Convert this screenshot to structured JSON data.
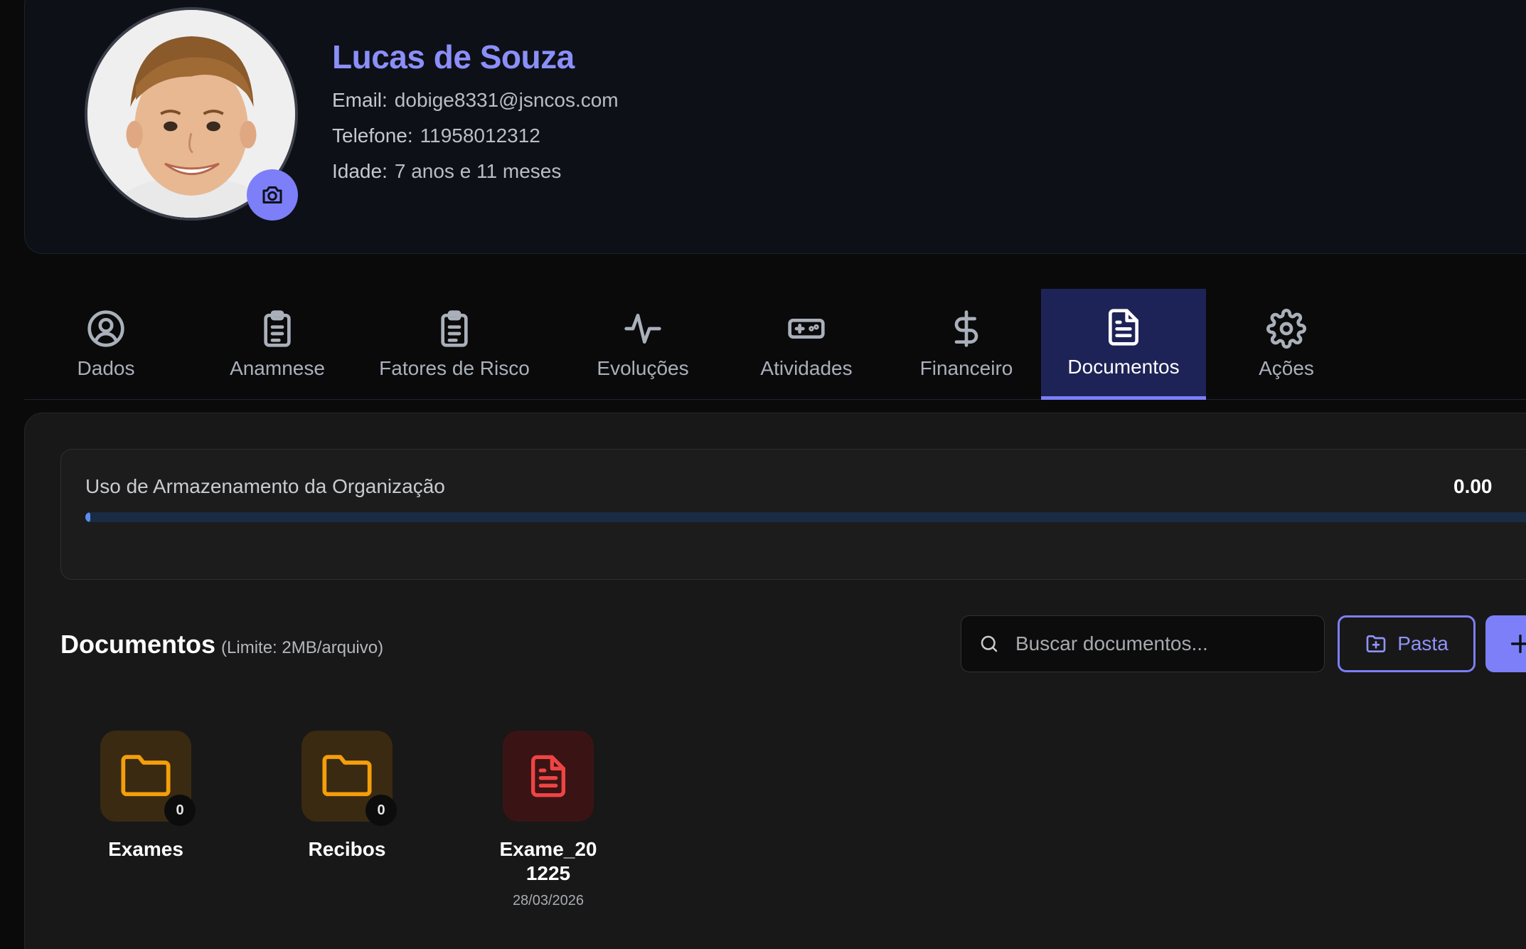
{
  "profile": {
    "name": "Lucas de Souza",
    "email_label": "Email:",
    "email": "dobige8331@jsncos.com",
    "phone_label": "Telefone:",
    "phone": "11958012312",
    "age_label": "Idade:",
    "age": "7 anos e 11 meses",
    "avatar_alt": "Foto do paciente"
  },
  "tabs": [
    {
      "label": "Dados",
      "icon": "user-circle-icon",
      "active": false
    },
    {
      "label": "Anamnese",
      "icon": "clipboard-list-icon",
      "active": false
    },
    {
      "label": "Fatores de Risco",
      "icon": "clipboard-list-icon",
      "active": false
    },
    {
      "label": "Evoluções",
      "icon": "activity-icon",
      "active": false
    },
    {
      "label": "Atividades",
      "icon": "gamepad-icon",
      "active": false
    },
    {
      "label": "Financeiro",
      "icon": "dollar-icon",
      "active": false
    },
    {
      "label": "Documentos",
      "icon": "file-text-icon",
      "active": true
    },
    {
      "label": "Ações",
      "icon": "gear-icon",
      "active": false
    }
  ],
  "storage": {
    "label": "Uso de Armazenamento da Organização",
    "value_text": "0.00",
    "fraction_used": 0.003
  },
  "documents": {
    "title": "Documentos",
    "limit": "(Limite: 2MB/arquivo)",
    "search_placeholder": "Buscar documentos...",
    "folder_button": "Pasta",
    "items": [
      {
        "type": "folder",
        "name": "Exames",
        "count": "0"
      },
      {
        "type": "folder",
        "name": "Recibos",
        "count": "0"
      },
      {
        "type": "file",
        "name": "Exame_201225",
        "date": "28/03/2026"
      }
    ]
  },
  "colors": {
    "accent": "#7c7ff7",
    "name": "#8b8ff8",
    "folder": "#f59e0b",
    "file": "#ef4444",
    "active_tab_bg": "#1e2357"
  }
}
